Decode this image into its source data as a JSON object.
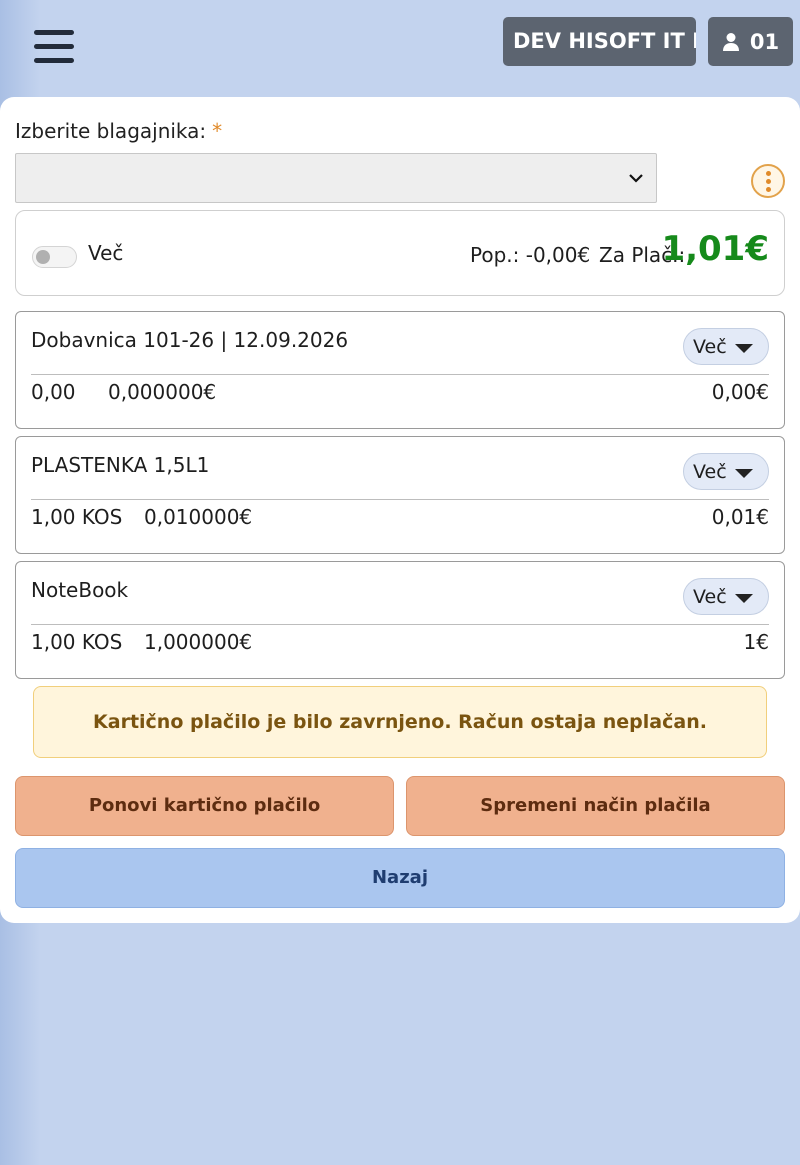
{
  "header": {
    "company_label": "DEV HISOFT IT I...",
    "user_label": "01",
    "menu_icon": "hamburger-icon",
    "user_icon": "person-icon"
  },
  "cashier": {
    "label": "Izberite blagajnika:",
    "required_mark": "*",
    "selected_value": "",
    "more_icon": "kebab-icon"
  },
  "summary": {
    "toggle_label": "Več",
    "toggle_on": false,
    "discount_label": "Pop.:",
    "discount_value": "-0,00€",
    "to_pay_label": "Za Plač.:",
    "to_pay_value": "1,01€",
    "to_pay_color": "#168a1b"
  },
  "items": [
    {
      "title": "Dobavnica 101-26 | 12.09.2026",
      "more_label": "Več",
      "qty": "0,00",
      "unit_price": "0,000000€",
      "total": "0,00€"
    },
    {
      "title": "PLASTENKA 1,5L1",
      "more_label": "Več",
      "qty": "1,00 KOS",
      "unit_price": "0,010000€",
      "total": "0,01€"
    },
    {
      "title": "NoteBook",
      "more_label": "Več",
      "qty": "1,00 KOS",
      "unit_price": "1,000000€",
      "total": "1€"
    }
  ],
  "alert": {
    "message": "Kartično plačilo je bilo zavrnjeno. Račun ostaja neplačan."
  },
  "actions": {
    "retry_label": "Ponovi kartično plačilo",
    "change_label": "Spremeni način plačila",
    "back_label": "Nazaj"
  },
  "colors": {
    "background": "#c3d3ee",
    "header_button": "#5c6470",
    "accent_orange": "#f0b18e",
    "back_button": "#aac6ef",
    "alert_bg": "#fff5dc"
  }
}
